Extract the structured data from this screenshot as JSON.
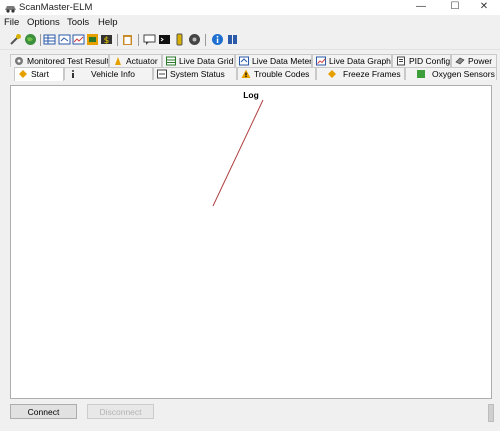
{
  "window": {
    "title": "ScanMaster-ELM",
    "controls": {
      "minimize": "—",
      "maximize": "☐",
      "close": "✕"
    }
  },
  "menu": [
    "File",
    "Options",
    "Tools",
    "Help"
  ],
  "toolbar": {
    "icons": [
      "connect-wrench-icon",
      "globe-icon",
      "grid-icon",
      "meter-icon",
      "graph-icon",
      "dtc-icon",
      "money-icon",
      "clipboard-icon",
      "chat-icon",
      "terminal-icon",
      "battery-icon",
      "tire-icon",
      "info-icon",
      "book-icon"
    ]
  },
  "tabs": {
    "row1": [
      {
        "label": "Monitored Test Results",
        "icon": "gear-icon"
      },
      {
        "label": "Actuator",
        "icon": "actuator-icon"
      },
      {
        "label": "Live Data Grid",
        "icon": "grid-icon"
      },
      {
        "label": "Live Data Meter",
        "icon": "meter-icon"
      },
      {
        "label": "Live Data Graph",
        "icon": "graph-icon"
      },
      {
        "label": "PID Config",
        "icon": "pid-config-icon"
      },
      {
        "label": "Power",
        "icon": "power-icon"
      }
    ],
    "row2": [
      {
        "label": "Start",
        "icon": "start-icon"
      },
      {
        "label": "Vehicle Info",
        "icon": "info-icon"
      },
      {
        "label": "System Status",
        "icon": "system-status-icon"
      },
      {
        "label": "Trouble Codes",
        "icon": "warning-icon"
      },
      {
        "label": "Freeze Frames",
        "icon": "freeze-frame-icon"
      },
      {
        "label": "Oxygen Sensors",
        "icon": "oxygen-sensor-icon"
      }
    ],
    "active": "Start"
  },
  "log": {
    "title": "Log"
  },
  "buttons": {
    "connect": "Connect",
    "disconnect": "Disconnect"
  },
  "colors": {
    "accent": "#1e6fd0",
    "pointer": "#b04040",
    "warning": "#e8a200"
  }
}
